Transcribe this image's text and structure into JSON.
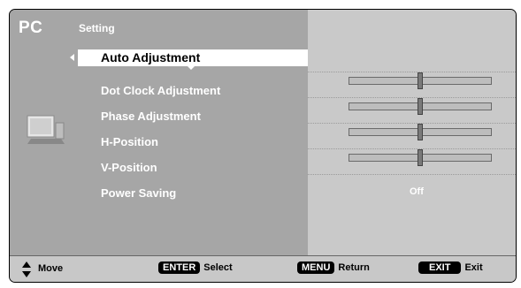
{
  "header": {
    "pc": "PC",
    "setting": "Setting"
  },
  "menu": {
    "items": [
      {
        "label": "Auto Adjustment",
        "selected": true
      },
      {
        "label": "Dot Clock Adjustment",
        "slider": 0.5
      },
      {
        "label": "Phase Adjustment",
        "slider": 0.5
      },
      {
        "label": "H-Position",
        "slider": 0.5
      },
      {
        "label": "V-Position",
        "slider": 0.5
      },
      {
        "label": "Power Saving",
        "value": "Off"
      }
    ]
  },
  "footer": {
    "move": "Move",
    "enter_key": "ENTER",
    "select": "Select",
    "menu_key": "MENU",
    "return": "Return",
    "exit_key": "EXIT",
    "exit": "Exit"
  },
  "icons": [
    "pc-monitor-icon",
    "up-down-arrow-icon",
    "left-arrow-icon",
    "down-arrow-icon"
  ]
}
